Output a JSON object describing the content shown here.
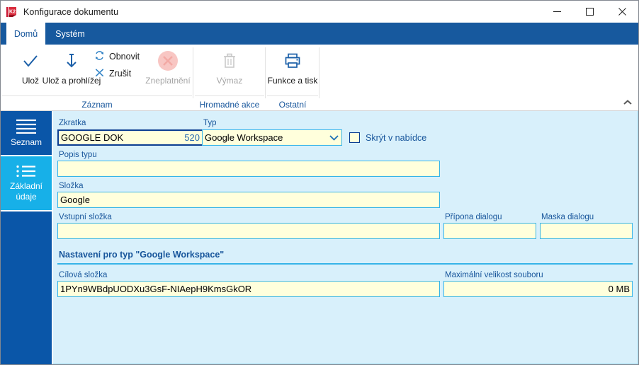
{
  "window": {
    "title": "Konfigurace dokumentu",
    "app_icon": "k2-logo-icon",
    "minimize_label": "—",
    "maximize_label": "□",
    "close_label": "✕"
  },
  "ribbon": {
    "tabs": [
      {
        "label": "Domů",
        "active": true
      },
      {
        "label": "Systém",
        "active": false
      }
    ],
    "collapse_icon": "chevron-up-icon",
    "groups": [
      {
        "name": "zaznam",
        "label": "Záznam",
        "big_buttons": [
          {
            "label": "Ulož",
            "icon": "check-icon",
            "disabled": false
          },
          {
            "label": "Ulož a prohlížej",
            "icon": "save-and-view-icon",
            "disabled": false
          },
          {
            "label": "Zneplatnění",
            "icon": "invalidate-circle-x-icon",
            "disabled": true
          }
        ],
        "small_buttons": [
          {
            "label": "Obnovit",
            "icon": "refresh-icon",
            "disabled": false
          },
          {
            "label": "Zrušit",
            "icon": "cancel-x-icon",
            "disabled": false
          }
        ]
      },
      {
        "name": "hromadne-akce",
        "label": "Hromadné akce",
        "big_buttons": [
          {
            "label": "Výmaz",
            "icon": "trash-icon",
            "disabled": true
          }
        ],
        "small_buttons": []
      },
      {
        "name": "ostatni",
        "label": "Ostatní",
        "big_buttons": [
          {
            "label": "Funkce a tisk",
            "icon": "printer-icon",
            "disabled": false
          }
        ],
        "small_buttons": []
      }
    ]
  },
  "sidebar": {
    "items": [
      {
        "label": "Seznam",
        "icon": "list-lines-icon",
        "active": false
      },
      {
        "label": "Základní údaje",
        "icon": "bullet-list-icon",
        "active": true
      }
    ]
  },
  "form": {
    "zkratka": {
      "label": "Zkratka",
      "value": "GOOGLE DOK",
      "number": "520"
    },
    "typ": {
      "label": "Typ",
      "value": "Google Workspace",
      "arrow_icon": "chevron-down-icon"
    },
    "skryt": {
      "label": "Skrýt v nabídce",
      "checked": false
    },
    "popis_typu": {
      "label": "Popis typu",
      "value": ""
    },
    "slozka": {
      "label": "Složka",
      "value": "Google"
    },
    "vstupni_slozka": {
      "label": "Vstupní složka",
      "value": ""
    },
    "pripona_dialogu": {
      "label": "Přípona dialogu",
      "value": ""
    },
    "maska_dialogu": {
      "label": "Maska dialogu",
      "value": ""
    },
    "section": {
      "title": "Nastavení pro typ \"Google Workspace\""
    },
    "cilova_slozka": {
      "label": "Cílová složka",
      "value": "1PYn9WBdpUODXu3GsF-NIAepH9KmsGkOR"
    },
    "maximalni_velikost": {
      "label": "Maximální velikost souboru",
      "value": "0 MB"
    }
  },
  "colors": {
    "ribbon_blue": "#17599e",
    "nav_blue": "#0a56a8",
    "nav_active": "#17b0e8",
    "panel_bg": "#d8f0fb",
    "field_bg": "#ffffdc",
    "field_border": "#36b4e8",
    "label_text": "#17559b",
    "focus_border": "#0b3d91"
  }
}
